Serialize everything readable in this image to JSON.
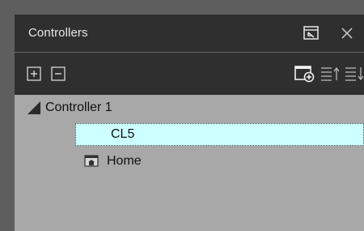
{
  "window": {
    "title": "Controllers"
  },
  "toolbar": {
    "icons": [
      "add-icon",
      "remove-icon",
      "add-screen-icon",
      "sort-ascending-icon",
      "sort-descending-icon"
    ]
  },
  "tree": {
    "root": {
      "label": "Controller 1",
      "icon": "triangle-expand-icon",
      "children": [
        {
          "label": "CL5",
          "selected": true
        },
        {
          "label": "Home",
          "icon": "home-screen-icon"
        }
      ]
    }
  },
  "colors": {
    "panel_bg": "#2f2f2f",
    "tree_bg": "#a8a8a8",
    "selection_bg": "#ccffff",
    "text_light": "#e8e8e8"
  }
}
